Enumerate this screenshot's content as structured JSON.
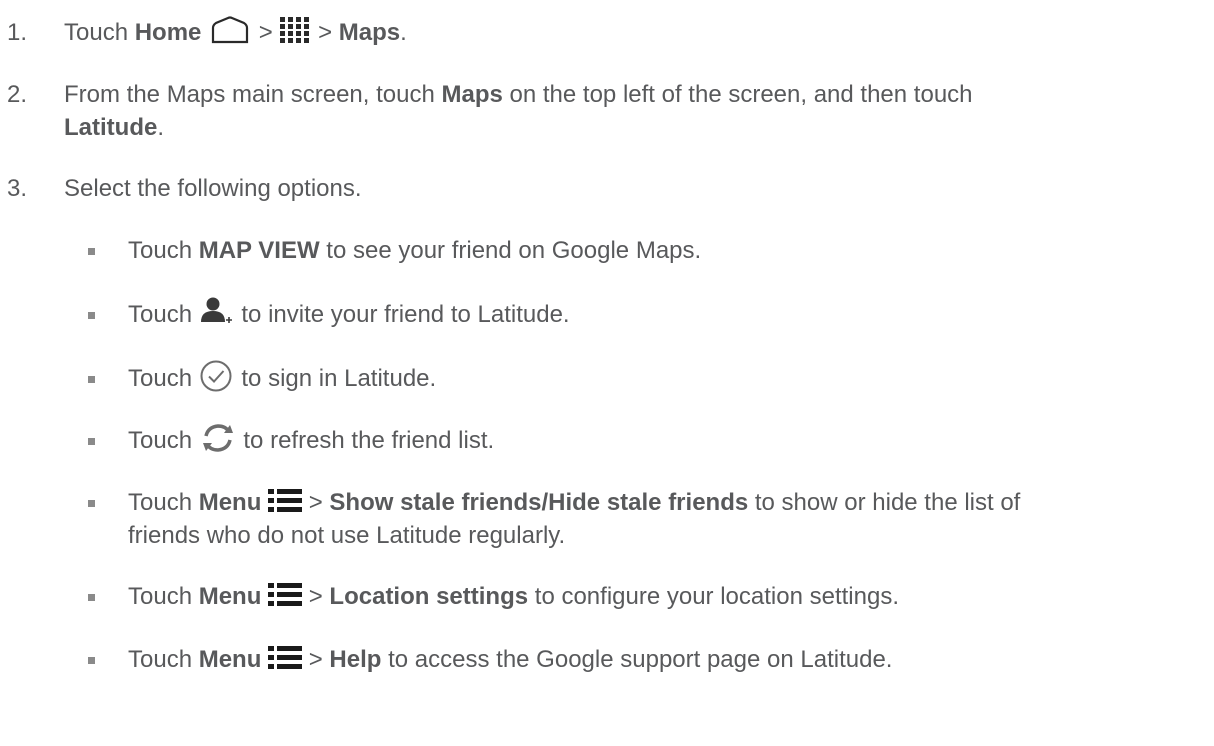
{
  "steps": [
    {
      "number": "1.",
      "pre": "Touch ",
      "home_label": "Home",
      "sep1": " > ",
      "sep2": " > ",
      "maps_label": "Maps",
      "end": "."
    },
    {
      "number": "2.",
      "line1_pre": "From the Maps main screen, touch ",
      "line1_bold": "Maps",
      "line1_post": " on the top left of the screen, and then touch",
      "line2_bold": "Latitude",
      "line2_post": "."
    },
    {
      "number": "3.",
      "text": "Select the following options."
    }
  ],
  "bullets": [
    {
      "pre": "Touch ",
      "bold": "MAP VIEW",
      "post": " to see your friend on Google Maps."
    },
    {
      "pre": "Touch ",
      "post": " to invite your friend to Latitude.",
      "icon": "add-person-icon"
    },
    {
      "pre": "Touch ",
      "post": " to sign in Latitude.",
      "icon": "check-circle-icon"
    },
    {
      "pre": "Touch ",
      "post": " to refresh the friend list.",
      "icon": "refresh-icon"
    },
    {
      "pre": "Touch ",
      "bold1": "Menu",
      "sep": " > ",
      "bold2": "Show stale friends/Hide stale friends",
      "post": " to show or hide the list of",
      "line2": "friends who do not use Latitude regularly.",
      "icon": "menu-icon"
    },
    {
      "pre": "Touch ",
      "bold1": "Menu",
      "sep": " > ",
      "bold2": "Location settings",
      "post": " to configure your location settings.",
      "icon": "menu-icon"
    },
    {
      "pre": "Touch ",
      "bold1": "Menu",
      "sep": " > ",
      "bold2": "Help",
      "post": " to access the Google support page on Latitude.",
      "icon": "menu-icon"
    }
  ]
}
